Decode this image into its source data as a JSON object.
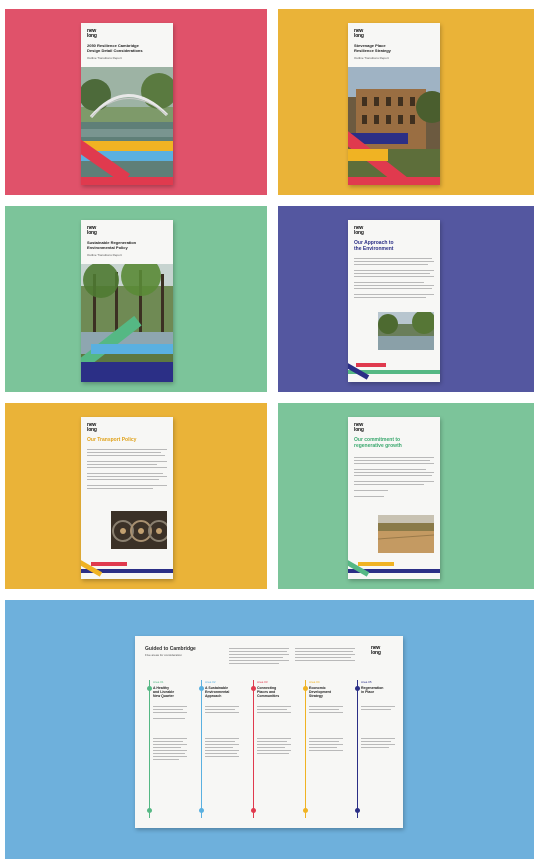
{
  "colors": {
    "red": "#e0526a",
    "yellow": "#eab338",
    "green": "#7cc49a",
    "navy": "#5457a0",
    "blue": "#6eb0dc",
    "doc_navy": "#2b2f86",
    "doc_red": "#e03a4e",
    "doc_yellow": "#f0b323",
    "doc_blue": "#5ab0e0",
    "doc_green": "#55b884"
  },
  "panels": [
    {
      "logo": "new\nlong",
      "title": "2050 Resilience Cambridge\nDesign Detail Considerations",
      "subtitle": "Outline Transitions Report",
      "photo": "bridge over river"
    },
    {
      "logo": "new\nlong",
      "title": "Stevenage Place\nResilience Strategy",
      "subtitle": "Outline Transitions Report",
      "photo": "historic college building"
    },
    {
      "logo": "new\nlong",
      "title": "Sustainable Regeneration\nEnvironmental Policy",
      "subtitle": "Outline Transitions Report",
      "photo": "tree lined riverside path"
    },
    {
      "logo": "new\nlong",
      "heading": "Our Approach to\nthe Environment",
      "photo": "river and trees"
    },
    {
      "logo": "new\nlong",
      "heading": "Our Transport Policy",
      "photo": "bicycles"
    },
    {
      "logo": "new\nlong",
      "heading": "Our commitment to\nregenerative growth",
      "photo": "aerial farmland"
    }
  ],
  "poster": {
    "logo": "new\nlong",
    "title": "Guided to Cambridge",
    "subtitle": "Five areas for consideration",
    "columns": [
      {
        "label": "Area 01",
        "title": "A Healthy\nand Liveable\nNew Quarter"
      },
      {
        "label": "Area 02",
        "title": "A Sustainable\nEnvironmental\nApproach"
      },
      {
        "label": "Area 03",
        "title": "Connecting\nPlaces and\nCommunities"
      },
      {
        "label": "Area 04",
        "title": "Economic\nDevelopment\nStrategy"
      },
      {
        "label": "Area 05",
        "title": "Regeneration\nin Place"
      }
    ]
  }
}
